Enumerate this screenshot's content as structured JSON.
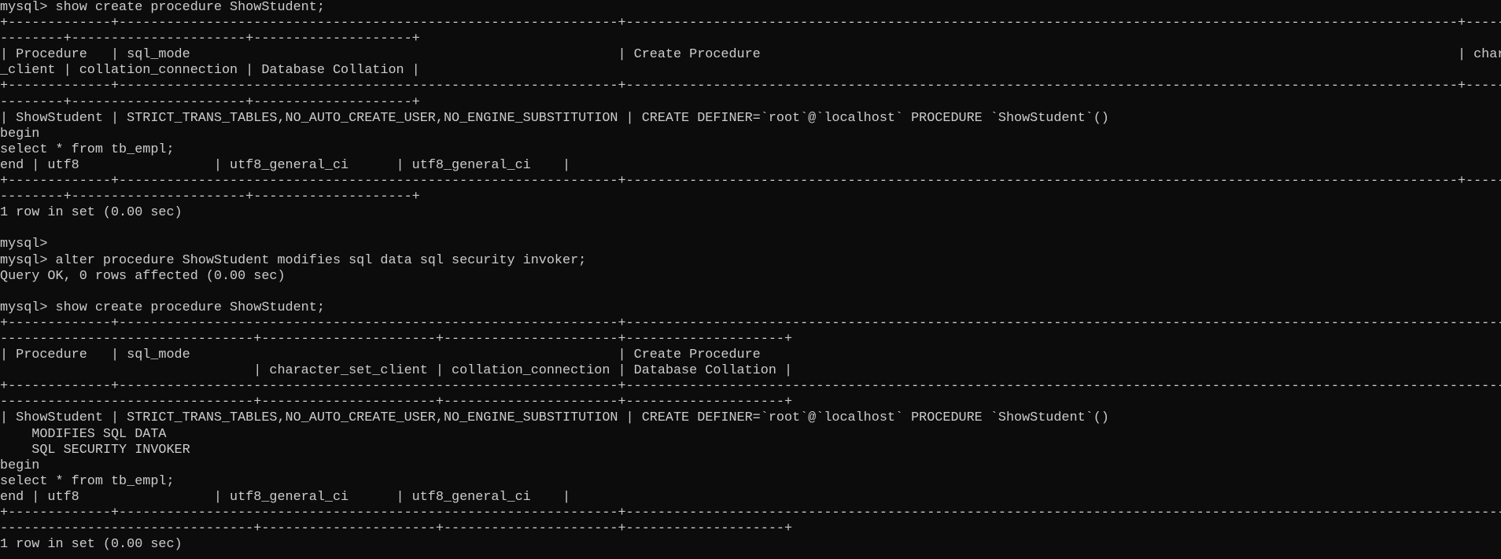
{
  "terminal": {
    "lines": [
      "mysql> show create procedure ShowStudent;",
      "+-------------+---------------------------------------------------------------+---------------------------------------------------------------------------------------------------------+--------------",
      "--------+----------------------+--------------------+",
      "| Procedure   | sql_mode                                                      | Create Procedure                                                                                        | character_set",
      "_client | collation_connection | Database Collation |",
      "+-------------+---------------------------------------------------------------+---------------------------------------------------------------------------------------------------------+--------------",
      "--------+----------------------+--------------------+",
      "| ShowStudent | STRICT_TRANS_TABLES,NO_AUTO_CREATE_USER,NO_ENGINE_SUBSTITUTION | CREATE DEFINER=`root`@`localhost` PROCEDURE `ShowStudent`()",
      "begin",
      "select * from tb_empl;",
      "end | utf8                 | utf8_general_ci      | utf8_general_ci    |",
      "+-------------+---------------------------------------------------------------+---------------------------------------------------------------------------------------------------------+--------------",
      "--------+----------------------+--------------------+",
      "1 row in set (0.00 sec)",
      "",
      "mysql>",
      "mysql> alter procedure ShowStudent modifies sql data sql security invoker;",
      "Query OK, 0 rows affected (0.00 sec)",
      "",
      "mysql> show create procedure ShowStudent;",
      "+-------------+---------------------------------------------------------------+---------------------------------------------------------------------------------------------------------------------------",
      "--------------------------------+----------------------+----------------------+--------------------+",
      "| Procedure   | sql_mode                                                      | Create Procedure",
      "                                | character_set_client | collation_connection | Database Collation |",
      "+-------------+---------------------------------------------------------------+---------------------------------------------------------------------------------------------------------------------------",
      "--------------------------------+----------------------+----------------------+--------------------+",
      "| ShowStudent | STRICT_TRANS_TABLES,NO_AUTO_CREATE_USER,NO_ENGINE_SUBSTITUTION | CREATE DEFINER=`root`@`localhost` PROCEDURE `ShowStudent`()",
      "    MODIFIES SQL DATA",
      "    SQL SECURITY INVOKER",
      "begin",
      "select * from tb_empl;",
      "end | utf8                 | utf8_general_ci      | utf8_general_ci    |",
      "+-------------+---------------------------------------------------------------+---------------------------------------------------------------------------------------------------------------------------",
      "--------------------------------+----------------------+----------------------+--------------------+",
      "1 row in set (0.00 sec)"
    ]
  }
}
